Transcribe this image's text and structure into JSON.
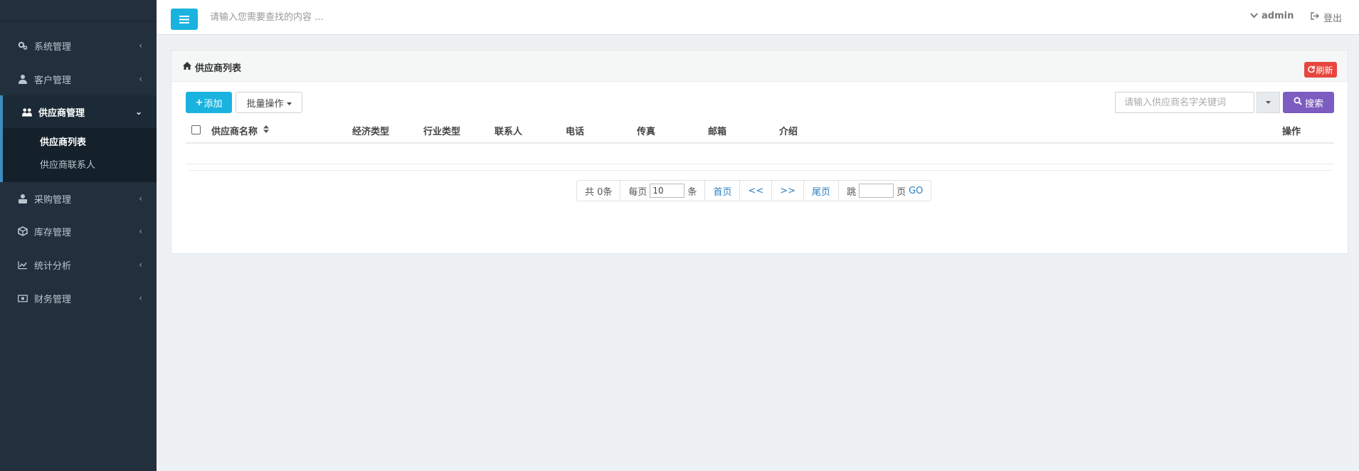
{
  "sidebar": {
    "items": [
      {
        "label": "系统管理",
        "icon": "gears-icon"
      },
      {
        "label": "客户管理",
        "icon": "user-icon"
      },
      {
        "label": "供应商管理",
        "icon": "users-icon"
      },
      {
        "label": "采购管理",
        "icon": "buyer-icon"
      },
      {
        "label": "库存管理",
        "icon": "cube-icon"
      },
      {
        "label": "统计分析",
        "icon": "line-chart-icon"
      },
      {
        "label": "财务管理",
        "icon": "money-icon"
      }
    ],
    "submenu": [
      {
        "label": "供应商列表"
      },
      {
        "label": "供应商联系人"
      }
    ]
  },
  "topbar": {
    "search_placeholder": "请输入您需要查找的内容 ...",
    "user": "admin",
    "logout": "登出"
  },
  "panel": {
    "title": "供应商列表",
    "refresh": "刷新"
  },
  "toolbar": {
    "add": "添加",
    "batch": "批量操作",
    "search_placeholder": "请输入供应商名字关键词",
    "search": "搜索"
  },
  "table": {
    "columns": [
      "供应商名称",
      "经济类型",
      "行业类型",
      "联系人",
      "电话",
      "传真",
      "邮箱",
      "介绍",
      "操作"
    ]
  },
  "pager": {
    "total": "共 0条",
    "per_page_label": "每页",
    "per_page_value": "10",
    "per_page_unit": "条",
    "first": "首页",
    "prev": "<<",
    "next": ">>",
    "last": "尾页",
    "jump_label": "跳",
    "page_unit": "页",
    "go": "GO"
  },
  "colors": {
    "sidebar_bg": "#22303d",
    "accent_blue": "#1ab3e0",
    "search_purple": "#7c5cc0",
    "refresh_red": "#e7463f"
  }
}
